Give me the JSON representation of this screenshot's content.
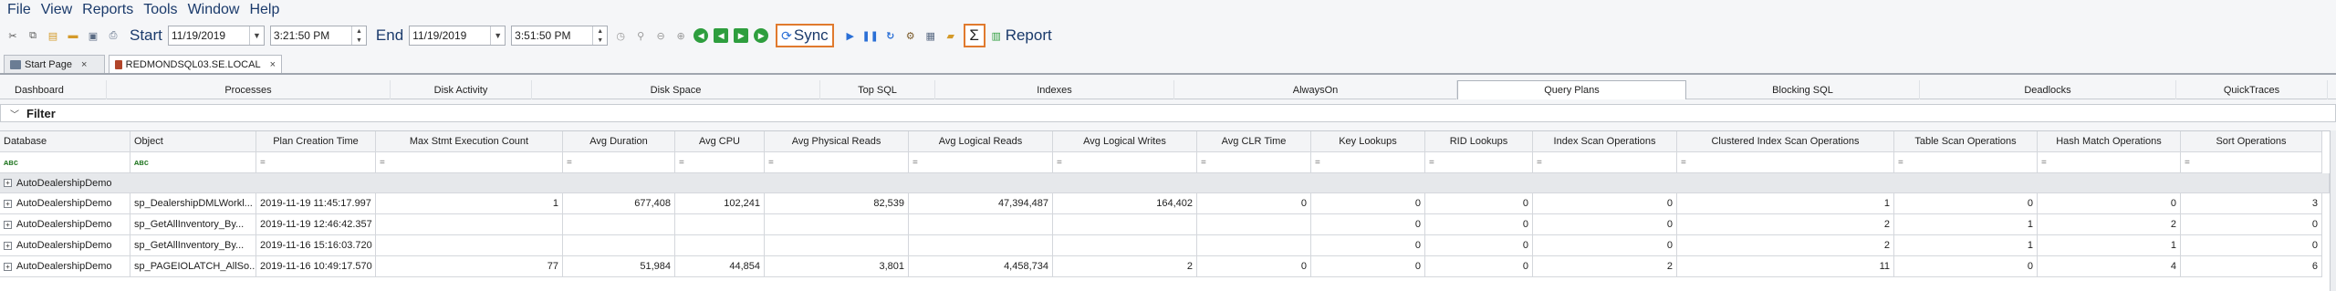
{
  "menu": [
    "File",
    "View",
    "Reports",
    "Tools",
    "Window",
    "Help"
  ],
  "toolbar": {
    "start_label": "Start",
    "start_date": "11/19/2019",
    "start_time": "3:21:50 PM",
    "end_label": "End",
    "end_date": "11/19/2019",
    "end_time": "3:51:50 PM",
    "sync_label": "Sync",
    "sigma_label": "Σ",
    "report_label": "Report"
  },
  "doc_tabs": [
    {
      "label": "Start Page",
      "close": "×"
    },
    {
      "label": "REDMONDSQL03.SE.LOCAL",
      "close": "×"
    }
  ],
  "section_tabs": [
    "Dashboard",
    "Processes",
    "Disk Activity",
    "Disk Space",
    "Top SQL",
    "Indexes",
    "AlwaysOn",
    "Query Plans",
    "Blocking SQL",
    "Deadlocks",
    "QuickTraces"
  ],
  "active_section": "Query Plans",
  "filter": {
    "label": "Filter"
  },
  "grid": {
    "columns": [
      "Database",
      "Object",
      "Plan Creation Time",
      "Max Stmt Execution Count",
      "Avg Duration",
      "Avg CPU",
      "Avg Physical Reads",
      "Avg Logical Reads",
      "Avg Logical Writes",
      "Avg CLR Time",
      "Key Lookups",
      "RID Lookups",
      "Index Scan Operations",
      "Clustered Index Scan Operations",
      "Table Scan Operations",
      "Hash Match Operations",
      "Sort Operations"
    ],
    "filter_row": [
      "ᴀʙc",
      "ᴀʙc",
      "=",
      "=",
      "=",
      "=",
      "=",
      "=",
      "=",
      "=",
      "=",
      "=",
      "=",
      "=",
      "=",
      "=",
      "="
    ],
    "group": "AutoDealershipDemo",
    "rows": [
      [
        "AutoDealershipDemo",
        "sp_DealershipDMLWorkl...",
        "2019-11-19 11:45:17.997",
        "1",
        "677,408",
        "102,241",
        "82,539",
        "47,394,487",
        "164,402",
        "0",
        "0",
        "0",
        "0",
        "1",
        "0",
        "0",
        "3"
      ],
      [
        "AutoDealershipDemo",
        "sp_GetAllInventory_By...",
        "2019-11-19 12:46:42.357",
        "",
        "",
        "",
        "",
        "",
        "",
        "",
        "0",
        "0",
        "0",
        "2",
        "1",
        "2",
        "0"
      ],
      [
        "AutoDealershipDemo",
        "sp_GetAllInventory_By...",
        "2019-11-16 15:16:03.720",
        "",
        "",
        "",
        "",
        "",
        "",
        "",
        "0",
        "0",
        "0",
        "2",
        "1",
        "1",
        "0"
      ],
      [
        "AutoDealershipDemo",
        "sp_PAGEIOLATCH_AllSo...",
        "2019-11-16 10:49:17.570",
        "77",
        "51,984",
        "44,854",
        "3,801",
        "4,458,734",
        "2",
        "0",
        "0",
        "0",
        "2",
        "11",
        "0",
        "4",
        "6"
      ]
    ]
  }
}
